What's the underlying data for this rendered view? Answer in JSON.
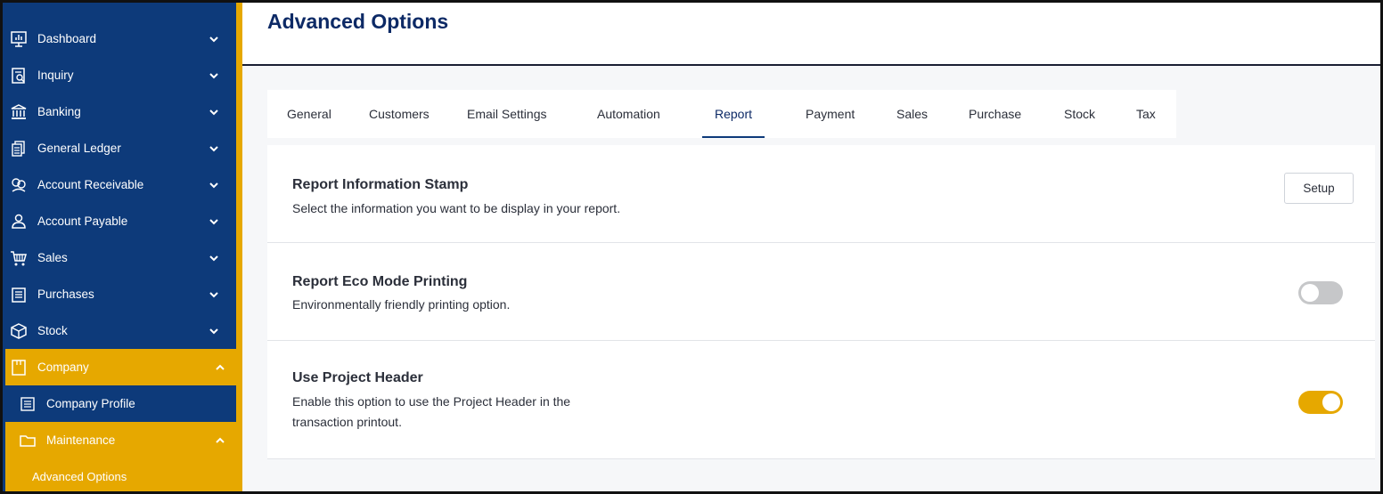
{
  "sidebar": {
    "items": [
      {
        "label": "Dashboard"
      },
      {
        "label": "Inquiry"
      },
      {
        "label": "Banking"
      },
      {
        "label": "General Ledger"
      },
      {
        "label": "Account Receivable"
      },
      {
        "label": "Account Payable"
      },
      {
        "label": "Sales"
      },
      {
        "label": "Purchases"
      },
      {
        "label": "Stock"
      },
      {
        "label": "Company"
      },
      {
        "label": "Company Profile"
      },
      {
        "label": "Maintenance"
      },
      {
        "label": "Advanced Options"
      }
    ]
  },
  "header": {
    "title": "Advanced Options"
  },
  "tabs": [
    {
      "label": "General"
    },
    {
      "label": "Customers"
    },
    {
      "label": "Email Settings"
    },
    {
      "label": "Automation"
    },
    {
      "label": "Report"
    },
    {
      "label": "Payment"
    },
    {
      "label": "Sales"
    },
    {
      "label": "Purchase"
    },
    {
      "label": "Stock"
    },
    {
      "label": "Tax"
    }
  ],
  "active_tab": "Report",
  "settings": [
    {
      "title": "Report Information Stamp",
      "description": "Select the information you want to be display in your report.",
      "action_label": "Setup"
    },
    {
      "title": "Report Eco Mode Printing",
      "description": "Environmentally friendly printing option.",
      "toggle": "off"
    },
    {
      "title": "Use Project Header",
      "description_line1": "Enable this option to use the Project Header in the",
      "description_line2": "transaction printout.",
      "toggle": "on"
    }
  ],
  "colors": {
    "navy": "#0d3a7a",
    "accent_yellow": "#e6a800",
    "title_navy": "#0d2a66"
  }
}
